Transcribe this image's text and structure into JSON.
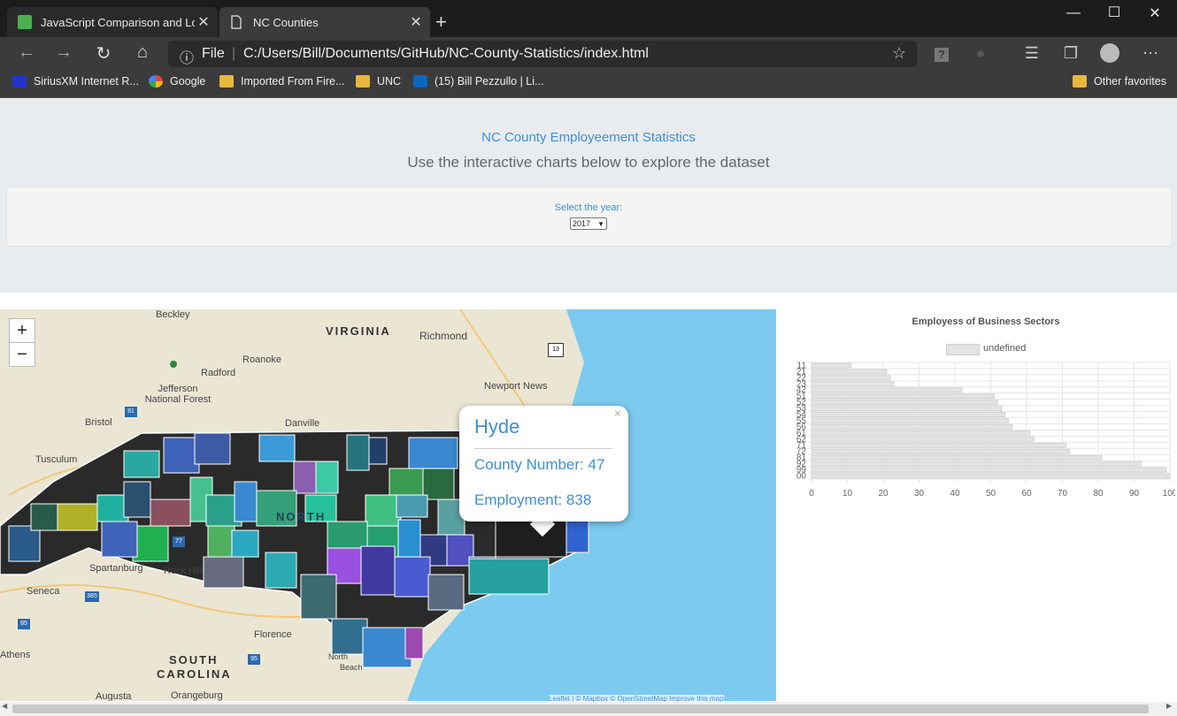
{
  "browser": {
    "tabs": [
      {
        "label": "JavaScript Comparison and Logic",
        "active": false
      },
      {
        "label": "NC Counties",
        "active": true
      }
    ],
    "new_tab": "+",
    "window_buttons": {
      "minimize": "—",
      "maximize": "☐",
      "close": "✕"
    },
    "address": {
      "scheme_label": "File",
      "url": "C:/Users/Bill/Documents/GitHub/NC-County-Statistics/index.html"
    },
    "bookmarks": [
      {
        "label": "SiriusXM Internet R...",
        "icon": "siriusxm-icon"
      },
      {
        "label": "Google",
        "icon": "google-icon"
      },
      {
        "label": "Imported From Fire...",
        "icon": "folder-icon"
      },
      {
        "label": "UNC",
        "icon": "folder-icon"
      },
      {
        "label": "(15) Bill Pezzullo | Li...",
        "icon": "linkedin-icon"
      }
    ],
    "other_favorites": "Other favorites"
  },
  "page": {
    "title": "NC County Employeement Statistics",
    "subtitle": "Use the interactive charts below to explore the dataset",
    "year_label": "Select the year:",
    "year_value": "2017"
  },
  "map": {
    "zoom_in": "+",
    "zoom_out": "−",
    "labels": [
      "Beckley",
      "VIRGINIA",
      "Richmond",
      "Roanoke",
      "Radford",
      "Jefferson National Forest",
      "Newport News",
      "Danville",
      "Bristol",
      "Tusculum",
      "NORTH",
      "Spartanburg",
      "Rock Hill",
      "Seneca",
      "Florence",
      "SOUTH",
      "CAROLINA",
      "Athens",
      "North",
      "Beach",
      "Augusta",
      "Orangeburg"
    ],
    "shields": [
      "81",
      "13",
      "77",
      "385",
      "85",
      "95"
    ],
    "popup": {
      "county": "Hyde",
      "county_number": "County Number: 47",
      "employment": "Employment: 838",
      "close": "×"
    },
    "attribution": "Leaflet | © Mapbox © OpenStreetMap Improve this map"
  },
  "chart_data": {
    "type": "bar",
    "orientation": "horizontal",
    "title": "Employess of Business Sectors",
    "legend": [
      "undefined"
    ],
    "categories": [
      "11",
      "21",
      "22",
      "23",
      "42",
      "51",
      "52",
      "53",
      "54",
      "55",
      "56",
      "61",
      "62",
      "71",
      "72",
      "81",
      "92",
      "99",
      "00"
    ],
    "series": [
      {
        "name": "undefined",
        "values": [
          11,
          21,
          22,
          23,
          42,
          51,
          52,
          53,
          54,
          55,
          56,
          61,
          62,
          71,
          72,
          81,
          92,
          99,
          100
        ]
      }
    ],
    "xlim": [
      0,
      100
    ],
    "xticks": [
      "0",
      "10",
      "20",
      "30",
      "40",
      "50",
      "60",
      "70",
      "80",
      "90",
      "100"
    ],
    "grid": true,
    "bar_color": "#e3e3e3",
    "bar_border": "#cfcfcf"
  },
  "colors": {
    "accent": "#3d8fd8",
    "tab_bar": "#1c1c1c",
    "toolbar": "#3b3b3b",
    "ocean": "#7ccaf0"
  }
}
